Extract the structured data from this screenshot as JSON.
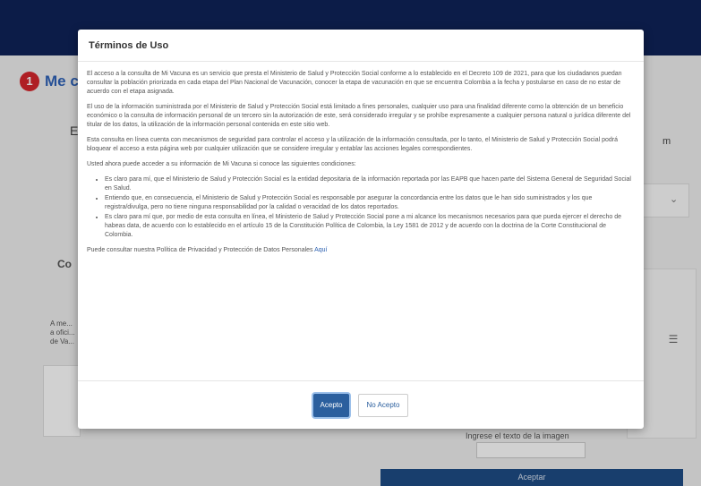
{
  "background": {
    "step_number": "1",
    "heading": "Me c",
    "fragment_e": "E",
    "fragment_side": "m",
    "fragment_left_bold": "Co",
    "fragment_left_para": "A me... a ofici... de Va...",
    "captcha_label": "Ingrese el texto de la imagen",
    "submit_label": "Aceptar"
  },
  "modal": {
    "title": "Términos de Uso",
    "p1": "El acceso a la consulta de Mi Vacuna es un servicio que presta el Ministerio de Salud y Protección Social conforme a lo establecido en el Decreto 109 de 2021, para que los ciudadanos puedan consultar la población priorizada en cada etapa del Plan Nacional de Vacunación, conocer la etapa de vacunación en que se encuentra Colombia a la fecha y postularse en caso de no estar de acuerdo con el etapa asignada.",
    "p2": "El uso de la información suministrada por el Ministerio de Salud y Protección Social está limitado a fines personales, cualquier uso para una finalidad diferente como la obtención de un beneficio económico o la consulta de información personal de un tercero sin la autorización de este, será considerado irregular y se prohíbe expresamente a cualquier persona natural o jurídica diferente del titular de los datos, la utilización de la información personal contenida en este sitio web.",
    "p3": "Esta consulta en línea cuenta con mecanismos de seguridad para controlar el acceso y la utilización de la información consultada, por lo tanto, el Ministerio de Salud y Protección Social podrá bloquear el acceso a esta página web por cualquier utilización que se considere irregular y entablar las acciones legales correspondientes.",
    "p4": "Usted ahora puede acceder a su información de Mi Vacuna si conoce las siguientes condiciones:",
    "bullets": [
      "Es claro para mí, que el Ministerio de Salud y Protección Social es la entidad depositaria de la información reportada por las EAPB que hacen parte del Sistema General de Seguridad Social en Salud.",
      "Entiendo que, en consecuencia, el Ministerio de Salud y Protección Social es responsable por asegurar la concordancia entre los datos que le han sido suministrados y los que registra/divulga, pero no tiene ninguna responsabilidad por la calidad o veracidad de los datos reportados.",
      "Es claro para mí que, por medio de esta consulta en línea, el Ministerio de Salud y Protección Social pone a mi alcance los mecanismos necesarios para que pueda ejercer el derecho de habeas data, de acuerdo con lo establecido en el artículo 15 de la Constitución Política de Colombia, la Ley 1581 de 2012 y de acuerdo con la doctrina de la Corte Constitucional de Colombia."
    ],
    "policy_text": "Puede consultar nuestra Política de Privacidad y Protección de Datos Personales",
    "policy_link": "Aquí",
    "accept_label": "Acepto",
    "decline_label": "No Acepto"
  }
}
